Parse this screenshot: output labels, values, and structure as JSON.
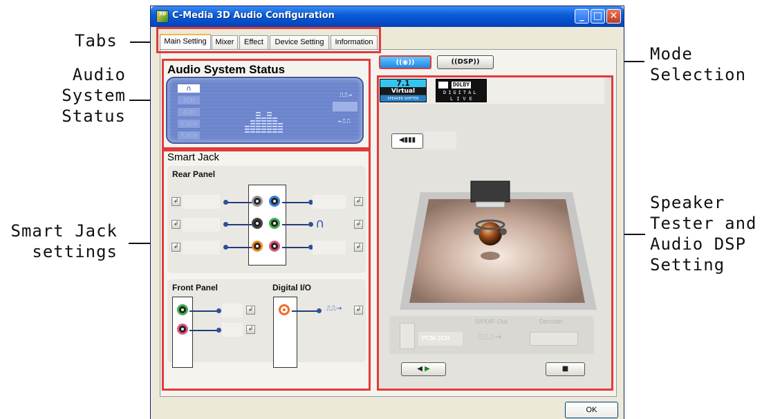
{
  "callouts": {
    "tabs": "Tabs",
    "audio_status": "Audio\nSystem\nStatus",
    "smart_jack": "Smart Jack\nsettings",
    "mode_selection": "Mode\nSelection",
    "speaker_tester": "Speaker\nTester and\nAudio DSP\nSetting"
  },
  "window": {
    "title": "C-Media 3D Audio Configuration",
    "icon_text": "3D",
    "ok_label": "OK"
  },
  "tabs": [
    "Main Setting",
    "Mixer",
    "Effect",
    "Device Setting",
    "Information"
  ],
  "audio_status": {
    "title": "Audio System Status",
    "channels": [
      "2CH",
      "4CH",
      "5.1CH",
      "7.1CH"
    ]
  },
  "smart_jack": {
    "title": "Smart Jack",
    "rear_panel": "Rear Panel",
    "front_panel": "Front Panel",
    "digital_io": "Digital I/O"
  },
  "speaker_tester": {
    "logo_71_top": "7.1",
    "logo_71_mid": "Virtual",
    "logo_71_bottom": "SPEAKER SHIFTER",
    "dolby_top": "DOLBY",
    "dolby_mid": "DIGITAL",
    "dolby_bottom": "LIVE",
    "spdif_out": "S/PDIF-Out",
    "decoder": "Decoder",
    "pcm_label": "PCM 2CH"
  },
  "colors": {
    "highlight": "#e33a3a",
    "title_bar": "#0a5fd8",
    "status_panel": "#6a83cd"
  }
}
